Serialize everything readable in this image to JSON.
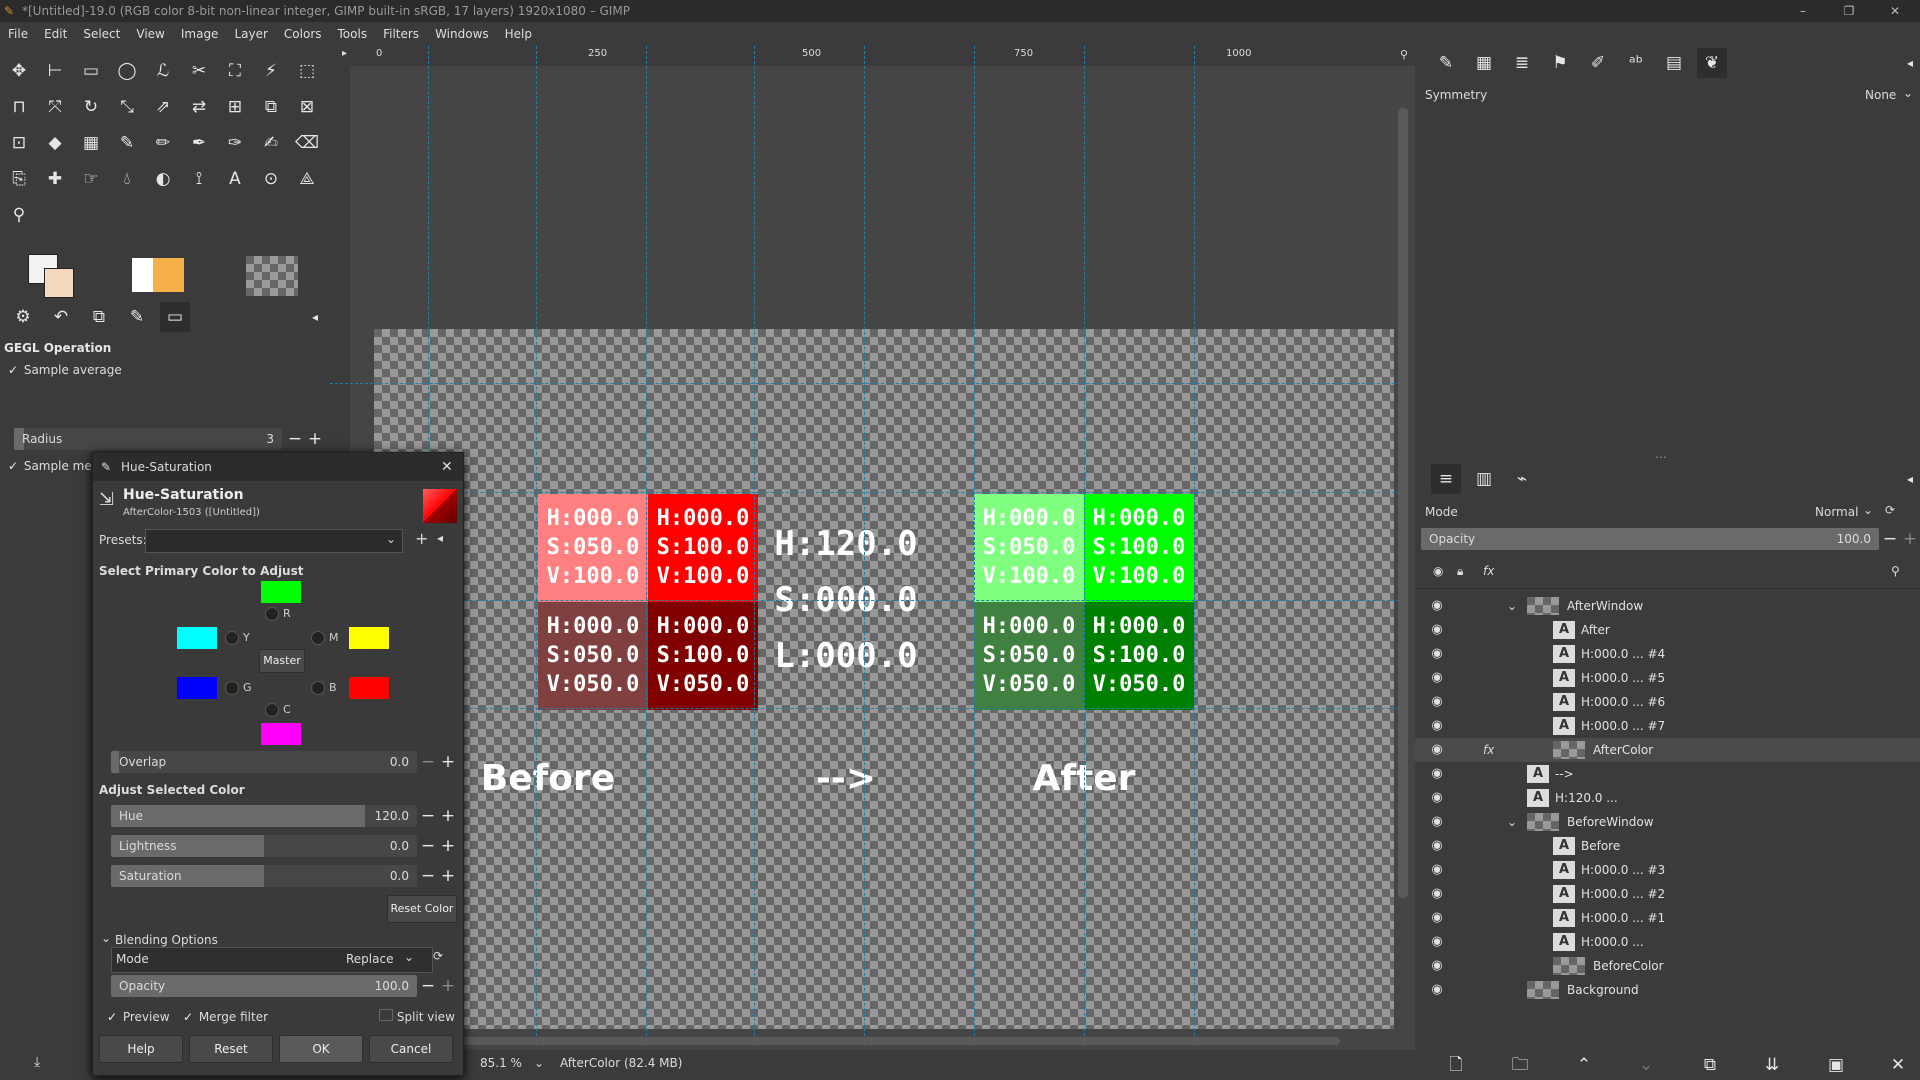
{
  "window": {
    "title": "*[Untitled]-19.0 (RGB color 8-bit non-linear integer, GIMP built-in sRGB, 17 layers) 1920x1080 – GIMP"
  },
  "menu": [
    "File",
    "Edit",
    "Select",
    "View",
    "Image",
    "Layer",
    "Colors",
    "Tools",
    "Filters",
    "Windows",
    "Help"
  ],
  "toolbox": {
    "tool_icons": [
      "move-icon",
      "align-icon",
      "rect-select-icon",
      "ellipse-select-icon",
      "free-select-icon",
      "scissors-select-icon",
      "foreground-select-icon",
      "fuzzy-select-icon",
      "select-by-color-icon",
      "crop-icon",
      "unified-transform-icon",
      "rotate-icon",
      "scale-icon",
      "shear-icon",
      "flip-icon",
      "perspective-icon",
      "3d-transform-icon",
      "warp-icon",
      "cage-icon",
      "bucket-fill-icon",
      "gradient-icon",
      "paintbrush-icon",
      "pencil-icon",
      "airbrush-icon",
      "ink-icon",
      "mypaint-brush-icon",
      "eraser-icon",
      "clone-icon",
      "heal-icon",
      "smudge-icon",
      "blur-icon",
      "dodge-burn-icon",
      "paths-icon",
      "text-icon",
      "color-picker-icon",
      "measure-icon",
      "zoom-icon"
    ],
    "options_title": "GEGL Operation",
    "sample_average": "Sample average",
    "radius_label": "Radius",
    "radius_value": "3",
    "sample_merged": "Sample merged"
  },
  "dialog": {
    "title": "Hue-Saturation",
    "heading": "Hue-Saturation",
    "subheading": "AfterColor-1503 ([Untitled])",
    "presets_label": "Presets:",
    "select_primary": "Select Primary Color to Adjust",
    "radio_labels": {
      "r": "R",
      "y": "Y",
      "g": "G",
      "c": "C",
      "b": "B",
      "m": "M"
    },
    "master": "Master",
    "overlap_label": "Overlap",
    "overlap_value": "0.0",
    "adjust_selected": "Adjust Selected Color",
    "hue_label": "Hue",
    "hue_value": "120.0",
    "hue_fraction": 0.83,
    "lightness_label": "Lightness",
    "lightness_value": "0.0",
    "saturation_label": "Saturation",
    "saturation_value": "0.0",
    "reset_color": "Reset Color",
    "blending_options": "Blending Options",
    "mode_label": "Mode",
    "mode_value": "Replace",
    "opacity_label": "Opacity",
    "opacity_value": "100.0",
    "preview": "Preview",
    "merge_filter": "Merge filter",
    "split_view": "Split view",
    "buttons": {
      "help": "Help",
      "reset": "Reset",
      "ok": "OK",
      "cancel": "Cancel"
    },
    "swatch_colors": {
      "r": "#ff0000",
      "y": "#ffff00",
      "g": "#00ff00",
      "c": "#00ffff",
      "b": "#0000ff",
      "m": "#ff00ff"
    }
  },
  "canvas": {
    "ruler_ticks": [
      "0",
      "250",
      "500",
      "750",
      "1000"
    ],
    "before_cells": [
      {
        "h": "H:000.0",
        "s": "S:050.0",
        "v": "V:100.0",
        "color": "#ff8080"
      },
      {
        "h": "H:000.0",
        "s": "S:100.0",
        "v": "V:100.0",
        "color": "#ff0000"
      },
      {
        "h": "H:000.0",
        "s": "S:050.0",
        "v": "V:050.0",
        "color": "#804040"
      },
      {
        "h": "H:000.0",
        "s": "S:100.0",
        "v": "V:050.0",
        "color": "#800000"
      }
    ],
    "after_cells": [
      {
        "h": "H:000.0",
        "s": "S:050.0",
        "v": "V:100.0",
        "color": "#80ff80"
      },
      {
        "h": "H:000.0",
        "s": "S:100.0",
        "v": "V:100.0",
        "color": "#00ff00"
      },
      {
        "h": "H:000.0",
        "s": "S:050.0",
        "v": "V:050.0",
        "color": "#408040"
      },
      {
        "h": "H:000.0",
        "s": "S:100.0",
        "v": "V:050.0",
        "color": "#008000"
      }
    ],
    "center_text": [
      "H:120.0",
      "S:000.0",
      "L:000.0"
    ],
    "before_label": "Before",
    "arrow_label": "-->",
    "after_label": "After",
    "zoom": "85.1 %",
    "status": "AfterColor (82.4 MB)"
  },
  "right": {
    "symmetry_label": "Symmetry",
    "symmetry_value": "None",
    "mode_label": "Mode",
    "mode_value": "Normal",
    "opacity_label": "Opacity",
    "opacity_value": "100.0",
    "layers": [
      {
        "name": "AfterWindow",
        "indent": 0,
        "type": "group",
        "expand": true
      },
      {
        "name": "After",
        "indent": 1,
        "type": "text"
      },
      {
        "name": "H:000.0 ... #4",
        "indent": 1,
        "type": "text"
      },
      {
        "name": "H:000.0 ... #5",
        "indent": 1,
        "type": "text"
      },
      {
        "name": "H:000.0 ... #6",
        "indent": 1,
        "type": "text"
      },
      {
        "name": "H:000.0 ... #7",
        "indent": 1,
        "type": "text"
      },
      {
        "name": "AfterColor",
        "indent": 1,
        "type": "image",
        "fx": true,
        "selected": true
      },
      {
        "name": "-->",
        "indent": 0,
        "type": "text"
      },
      {
        "name": "H:120.0 ...",
        "indent": 0,
        "type": "text"
      },
      {
        "name": "BeforeWindow",
        "indent": 0,
        "type": "group",
        "expand": true
      },
      {
        "name": "Before",
        "indent": 1,
        "type": "text"
      },
      {
        "name": "H:000.0 ... #3",
        "indent": 1,
        "type": "text"
      },
      {
        "name": "H:000.0 ... #2",
        "indent": 1,
        "type": "text"
      },
      {
        "name": "H:000.0 ... #1",
        "indent": 1,
        "type": "text"
      },
      {
        "name": "H:000.0 ...",
        "indent": 1,
        "type": "text"
      },
      {
        "name": "BeforeColor",
        "indent": 1,
        "type": "image"
      },
      {
        "name": "Background",
        "indent": 0,
        "type": "image"
      }
    ]
  }
}
